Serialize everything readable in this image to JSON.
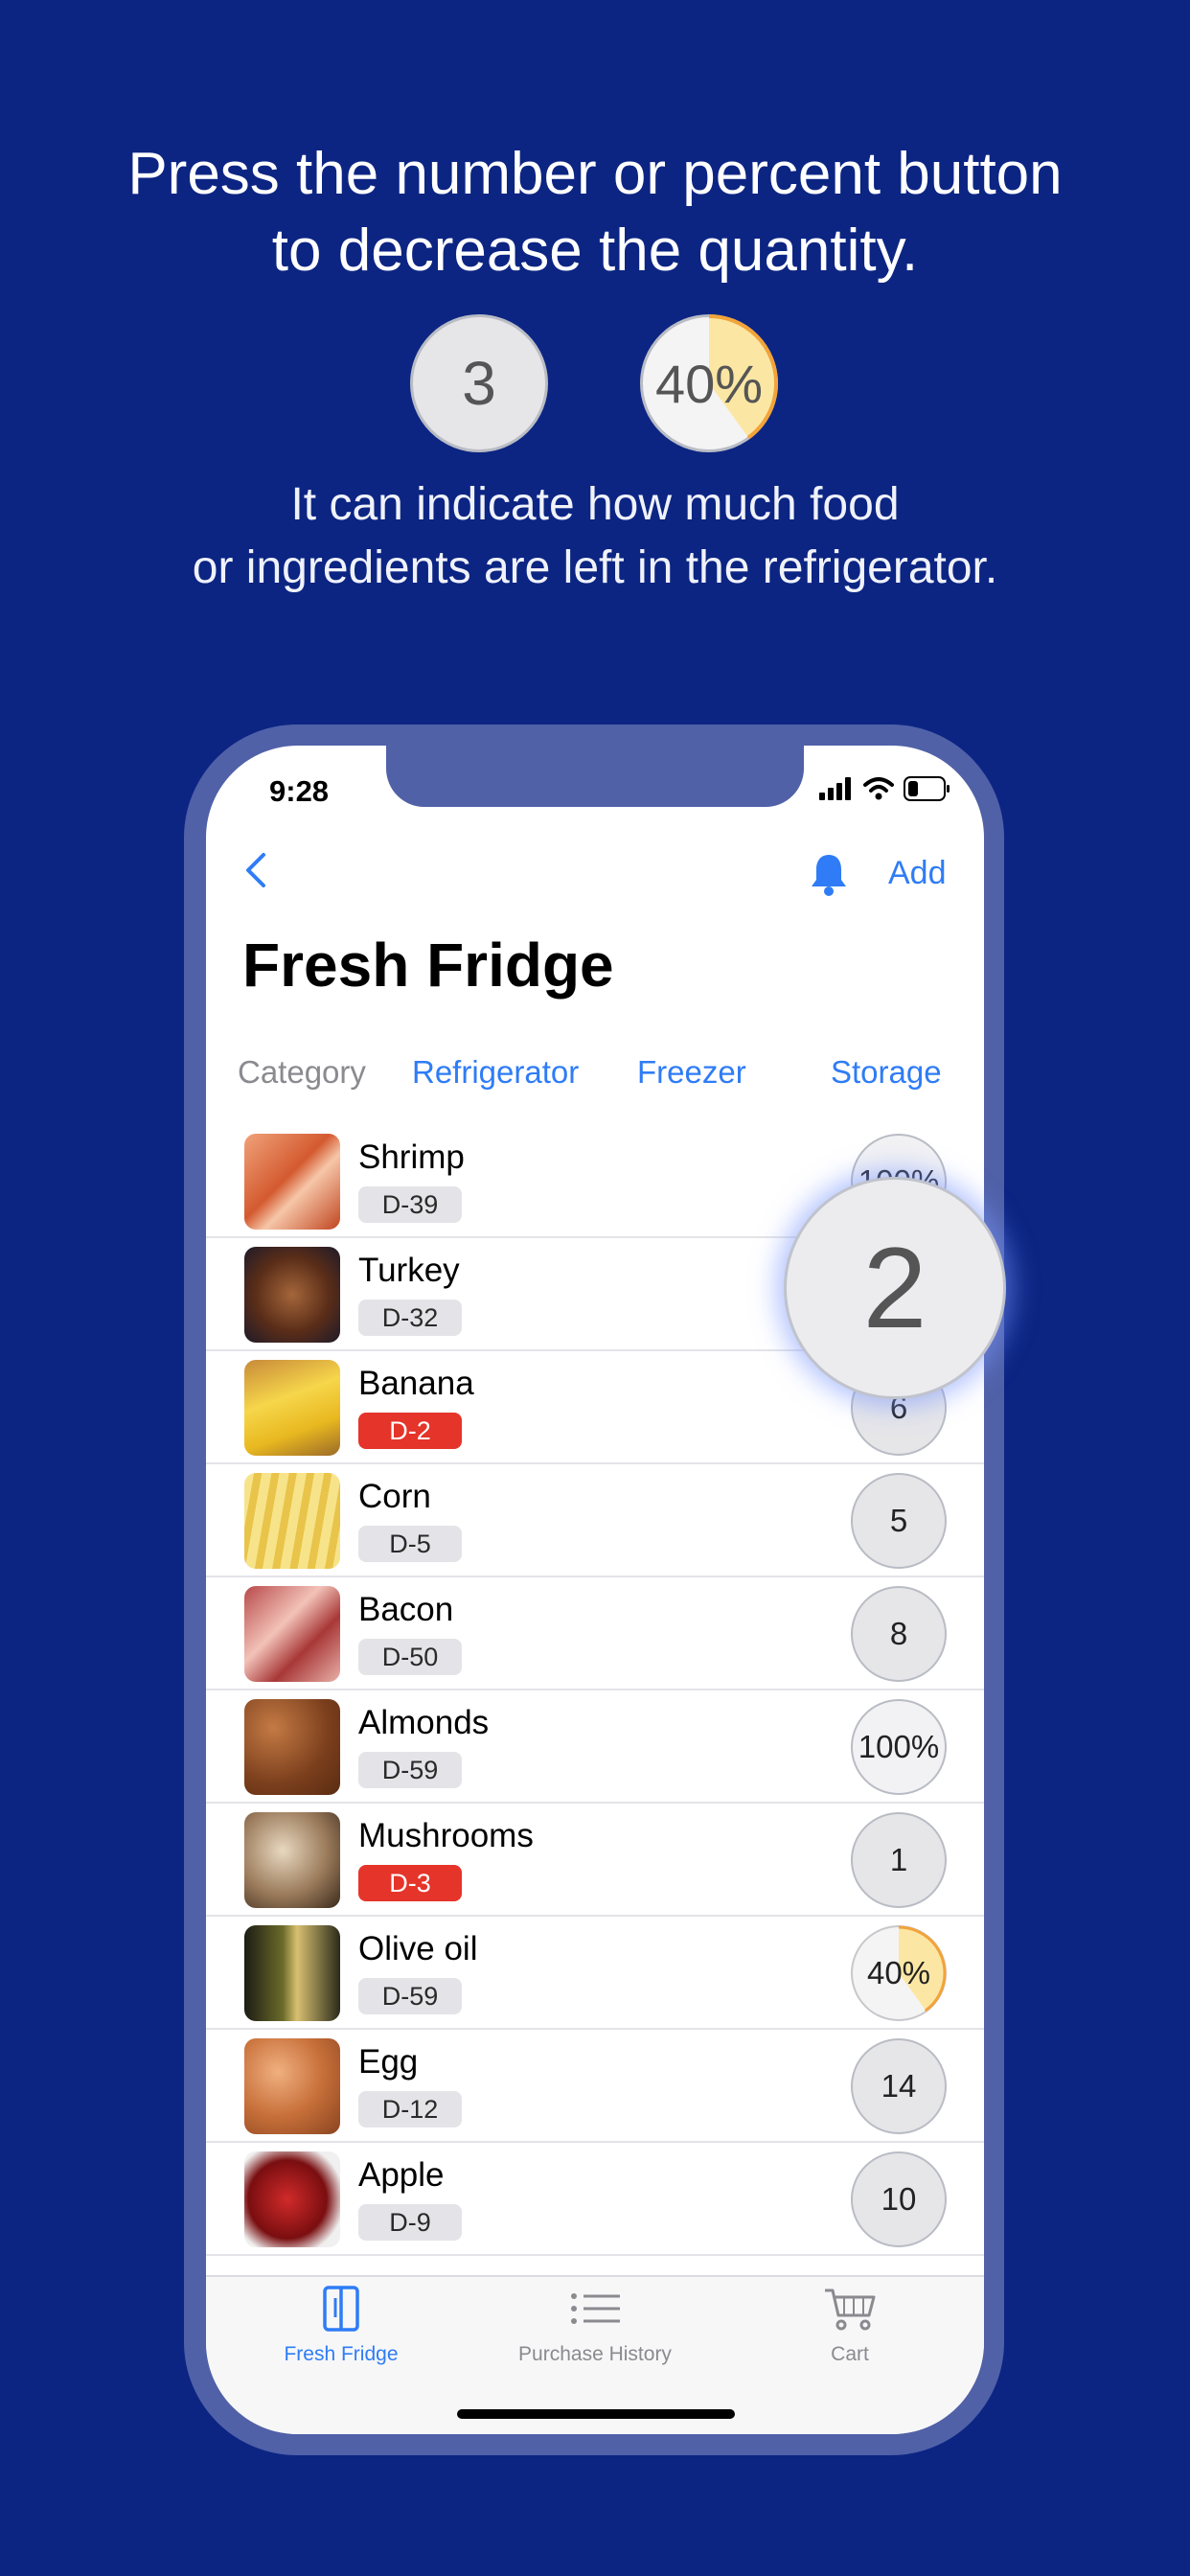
{
  "promo": {
    "headline": "Press the number or percent button\nto decrease the quantity.",
    "demo_number": "3",
    "demo_percent": "40%",
    "demo_percent_value": 0.4,
    "subtext": "It can indicate how much food\nor ingredients are left in the refrigerator."
  },
  "status": {
    "time": "9:28"
  },
  "nav": {
    "add_label": "Add"
  },
  "page_title": "Fresh Fridge",
  "categories": {
    "label": "Category",
    "items": [
      "Refrigerator",
      "Freezer",
      "Storage"
    ]
  },
  "items": [
    {
      "name": "Shrimp",
      "badge": "D-39",
      "urgent": false,
      "qty": "100%",
      "pct": 1.0
    },
    {
      "name": "Turkey",
      "badge": "D-32",
      "urgent": false,
      "qty": "",
      "pct": null
    },
    {
      "name": "Banana",
      "badge": "D-2",
      "urgent": true,
      "qty": "6",
      "pct": null
    },
    {
      "name": "Corn",
      "badge": "D-5",
      "urgent": false,
      "qty": "5",
      "pct": null
    },
    {
      "name": "Bacon",
      "badge": "D-50",
      "urgent": false,
      "qty": "8",
      "pct": null
    },
    {
      "name": "Almonds",
      "badge": "D-59",
      "urgent": false,
      "qty": "100%",
      "pct": 1.0
    },
    {
      "name": "Mushrooms",
      "badge": "D-3",
      "urgent": true,
      "qty": "1",
      "pct": null
    },
    {
      "name": "Olive oil",
      "badge": "D-59",
      "urgent": false,
      "qty": "40%",
      "pct": 0.4
    },
    {
      "name": "Egg",
      "badge": "D-12",
      "urgent": false,
      "qty": "14",
      "pct": null
    },
    {
      "name": "Apple",
      "badge": "D-9",
      "urgent": false,
      "qty": "10",
      "pct": null
    }
  ],
  "popup_quantity": "2",
  "tabs": [
    {
      "label": "Fresh Fridge",
      "icon": "fridge-icon",
      "active": true
    },
    {
      "label": "Purchase History",
      "icon": "list-icon",
      "active": false
    },
    {
      "label": "Cart",
      "icon": "cart-icon",
      "active": false
    }
  ],
  "colors": {
    "background": "#0c2583",
    "accent": "#2f7cf6",
    "urgent": "#e5342a",
    "percent_fill": "#fbe7a3"
  }
}
